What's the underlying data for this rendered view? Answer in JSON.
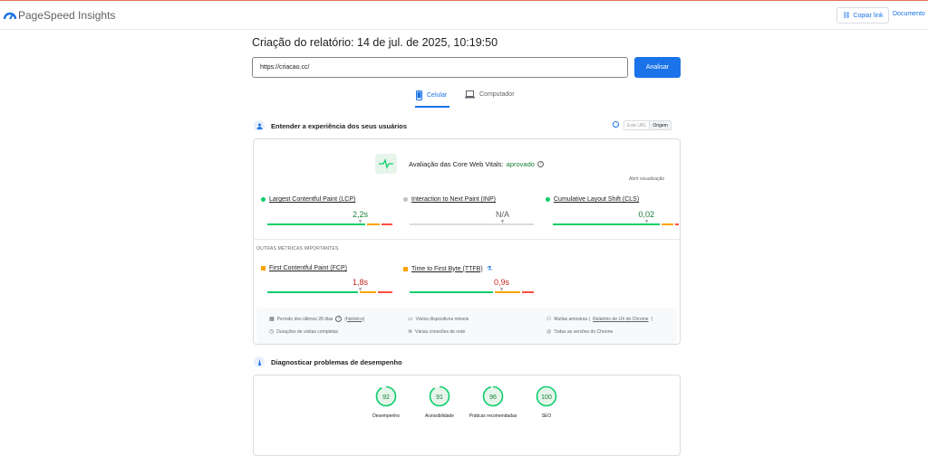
{
  "header": {
    "brand": "PageSpeed Insights",
    "copy_link": "Copiar link",
    "docs": "Documento"
  },
  "report": {
    "title": "Criação do relatório: 14 de jul. de 2025, 10:19:50",
    "url_value": "https://criacao.cc/",
    "analyze_label": "Analisar"
  },
  "tabs": [
    {
      "label": "Celular",
      "active": true,
      "icon": "phone-icon"
    },
    {
      "label": "Computador",
      "active": false,
      "icon": "laptop-icon"
    }
  ],
  "experience": {
    "heading": "Entender a experiência dos seus usuários",
    "toggle_url": "Este URL",
    "toggle_origin": "Origem",
    "cwv_label": "Avaliação das Core Web Vitals:",
    "cwv_status": "aprovado",
    "open_view": "Abrir visualização",
    "metrics": [
      {
        "name": "Largest Contentful Paint (LCP)",
        "value": "2,2s",
        "status_color": "#0cce6b",
        "value_color": "#188038"
      },
      {
        "name": "Interaction to Next Paint (INP)",
        "value": "N/A",
        "status_color": "#bdc1c6",
        "value_color": "#5f6368"
      },
      {
        "name": "Cumulative Layout Shift (CLS)",
        "value": "0,02",
        "status_color": "#0cce6b",
        "value_color": "#188038"
      }
    ],
    "other_title": "OUTRAS MÉTRICAS IMPORTANTES",
    "other_metrics": [
      {
        "name": "First Contentful Paint (FCP)",
        "value": "1,8s",
        "status_color": "#ffa400",
        "value_color": "#c5221f"
      },
      {
        "name": "Time to First Byte (TTFB)",
        "value": "0,9s",
        "status_color": "#ffa400",
        "value_color": "#c5221f"
      }
    ],
    "footer": {
      "period": "Período dos últimos 28 dias",
      "history": "(histórico)",
      "visits": "Durações de visitas completas",
      "devices": "Vários dispositivos móveis",
      "network": "Várias conexões de rede",
      "samples_prefix": "Muitas amostras (",
      "samples_link": "Relatório de UX do Chrome",
      "samples_suffix": ")",
      "chrome": "Todas as versões do Chrome"
    }
  },
  "diagnose": {
    "heading": "Diagnosticar problemas de desempenho",
    "scores": [
      {
        "value": "92",
        "label": "Desempenho"
      },
      {
        "value": "91",
        "label": "Acessibilidade"
      },
      {
        "value": "96",
        "label": "Práticas recomendadas"
      },
      {
        "value": "100",
        "label": "SEO"
      }
    ]
  },
  "colors": {
    "accent": "#1a73e8",
    "good": "#0cce6b",
    "average": "#ffa400",
    "poor": "#ff4e42"
  }
}
